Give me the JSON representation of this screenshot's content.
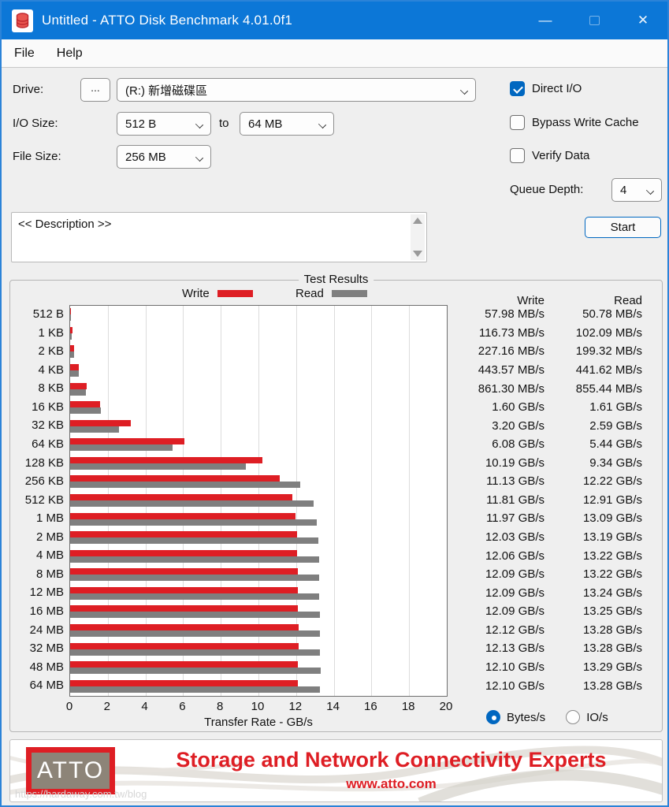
{
  "window": {
    "title": "Untitled - ATTO Disk Benchmark 4.01.0f1",
    "menu": [
      {
        "label": "File"
      },
      {
        "label": "Help"
      }
    ],
    "minimize_glyph": "—",
    "close_glyph": "✕"
  },
  "controls": {
    "drive_label": "Drive:",
    "browse_label": "...",
    "drive_value": "(R:) 新增磁碟區",
    "io_size_label": "I/O Size:",
    "io_from_value": "512 B",
    "to_label": "to",
    "io_to_value": "64 MB",
    "file_size_label": "File Size:",
    "file_size_value": "256 MB",
    "queue_depth_label": "Queue Depth:",
    "queue_depth_value": "4",
    "description_text": "<< Description >>",
    "start_label": "Start"
  },
  "options": {
    "direct_io": {
      "label": "Direct I/O",
      "checked": true
    },
    "bypass_write_cache": {
      "label": "Bypass Write Cache",
      "checked": false
    },
    "verify_data": {
      "label": "Verify Data",
      "checked": false
    }
  },
  "units": {
    "bytes": {
      "label": "Bytes/s",
      "selected": true
    },
    "io": {
      "label": "IO/s",
      "selected": false
    }
  },
  "colors": {
    "accent": "#0c77d7",
    "selection": "#0067c0",
    "write": "#de1e24",
    "read": "#7f7f7f"
  },
  "chart_data": {
    "type": "bar",
    "orientation": "horizontal",
    "title": "Test Results",
    "xlabel": "Transfer Rate - GB/s",
    "xlim": [
      0,
      20
    ],
    "xticks": [
      0,
      2,
      4,
      6,
      8,
      10,
      12,
      14,
      16,
      18,
      20
    ],
    "grid": true,
    "legend": {
      "write_label": "Write",
      "read_label": "Read"
    },
    "column_headers": {
      "write": "Write",
      "read": "Read"
    },
    "categories": [
      "512 B",
      "1 KB",
      "2 KB",
      "4 KB",
      "8 KB",
      "16 KB",
      "32 KB",
      "64 KB",
      "128 KB",
      "256 KB",
      "512 KB",
      "1 MB",
      "2 MB",
      "4 MB",
      "8 MB",
      "12 MB",
      "16 MB",
      "24 MB",
      "32 MB",
      "48 MB",
      "64 MB"
    ],
    "series": [
      {
        "name": "Write",
        "color": "#de1e24",
        "values_gbps": [
          0.058,
          0.117,
          0.227,
          0.444,
          0.861,
          1.6,
          3.2,
          6.08,
          10.19,
          11.13,
          11.81,
          11.97,
          12.03,
          12.06,
          12.09,
          12.09,
          12.09,
          12.12,
          12.13,
          12.1,
          12.1
        ]
      },
      {
        "name": "Read",
        "color": "#7f7f7f",
        "values_gbps": [
          0.051,
          0.102,
          0.199,
          0.442,
          0.855,
          1.61,
          2.59,
          5.44,
          9.34,
          12.22,
          12.91,
          13.09,
          13.19,
          13.22,
          13.22,
          13.24,
          13.25,
          13.28,
          13.28,
          13.29,
          13.28
        ]
      }
    ],
    "value_labels": {
      "write": [
        "57.98 MB/s",
        "116.73 MB/s",
        "227.16 MB/s",
        "443.57 MB/s",
        "861.30 MB/s",
        "1.60 GB/s",
        "3.20 GB/s",
        "6.08 GB/s",
        "10.19 GB/s",
        "11.13 GB/s",
        "11.81 GB/s",
        "11.97 GB/s",
        "12.03 GB/s",
        "12.06 GB/s",
        "12.09 GB/s",
        "12.09 GB/s",
        "12.09 GB/s",
        "12.12 GB/s",
        "12.13 GB/s",
        "12.10 GB/s",
        "12.10 GB/s"
      ],
      "read": [
        "50.78 MB/s",
        "102.09 MB/s",
        "199.32 MB/s",
        "441.62 MB/s",
        "855.44 MB/s",
        "1.61 GB/s",
        "2.59 GB/s",
        "5.44 GB/s",
        "9.34 GB/s",
        "12.22 GB/s",
        "12.91 GB/s",
        "13.09 GB/s",
        "13.19 GB/s",
        "13.22 GB/s",
        "13.22 GB/s",
        "13.24 GB/s",
        "13.25 GB/s",
        "13.28 GB/s",
        "13.28 GB/s",
        "13.29 GB/s",
        "13.28 GB/s"
      ]
    }
  },
  "footer": {
    "logo_text": "ATTO",
    "tagline": "Storage and Network Connectivity Experts",
    "url": "www.atto.com",
    "watermark": "https://hardaway.com.tw/blog"
  }
}
